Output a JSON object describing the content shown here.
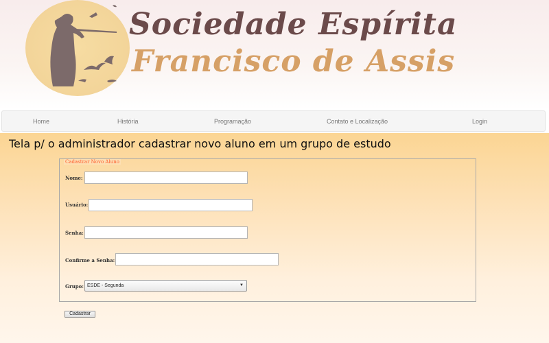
{
  "header": {
    "title_line1": "Sociedade Espírita",
    "title_line2": "Francisco de Assis",
    "logo_icon": "saint-francis-logo-icon"
  },
  "nav": {
    "items": [
      {
        "label": "Home"
      },
      {
        "label": "História"
      },
      {
        "label": "Programação"
      },
      {
        "label": "Contato e Localização"
      },
      {
        "label": "Login"
      }
    ]
  },
  "page": {
    "heading": "Tela p/ o administrador cadastrar novo aluno em um grupo de estudo"
  },
  "form": {
    "legend": "Cadastrar Novo Aluno",
    "fields": {
      "nome": {
        "label": "Nome:",
        "value": ""
      },
      "usuario": {
        "label": "Usuário:",
        "value": ""
      },
      "senha": {
        "label": "Senha:",
        "value": ""
      },
      "confirma": {
        "label": "Confirme a Senha:",
        "value": ""
      }
    },
    "grupo": {
      "label": "Grupo:",
      "selected": "ESDE - Segunda"
    },
    "submit_label": "Cadastrar"
  },
  "colors": {
    "title_dark": "#6b4a4a",
    "title_light": "#d6a066",
    "legend": "#ff5a2a",
    "content_bg": "#fde0b4"
  }
}
